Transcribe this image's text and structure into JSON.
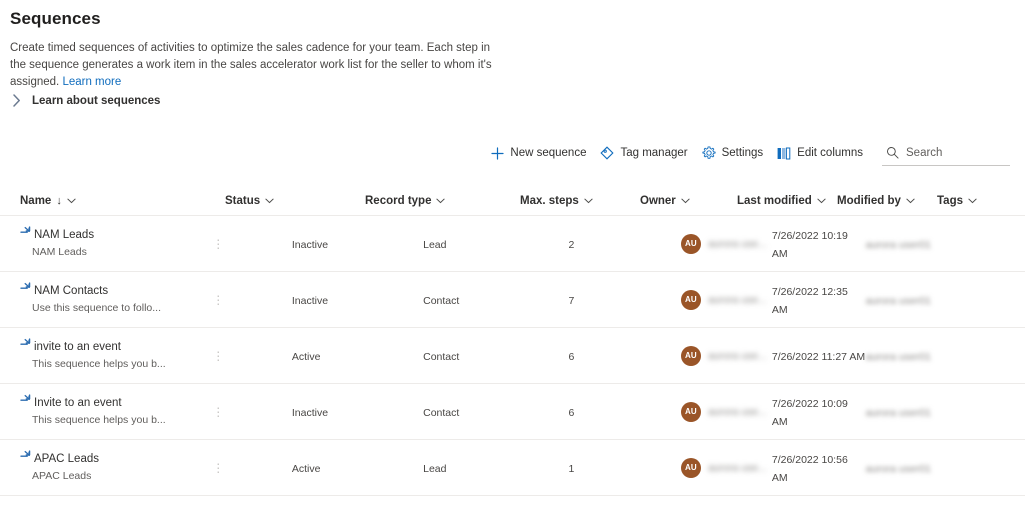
{
  "header": {
    "title": "Sequences",
    "description": "Create timed sequences of activities to optimize the sales cadence for your team. Each step in the sequence generates a work item in the sales accelerator work list for the seller to whom it's assigned.",
    "learn_more": "Learn more",
    "learn_about_label": "Learn about sequences",
    "chevron_icon": "chevron-right-icon"
  },
  "commandbar": {
    "new_sequence": "New sequence",
    "tag_manager": "Tag manager",
    "settings": "Settings",
    "edit_columns": "Edit columns",
    "icons": {
      "new": "plus-icon",
      "tag": "tag-icon",
      "settings": "gear-icon",
      "columns": "edit-columns-icon",
      "search": "search-icon"
    }
  },
  "search": {
    "placeholder": "Search",
    "value": ""
  },
  "table": {
    "columns": [
      {
        "label": "Name",
        "sort": "↓"
      },
      {
        "label": "Status"
      },
      {
        "label": "Record type"
      },
      {
        "label": "Max. steps"
      },
      {
        "label": "Owner"
      },
      {
        "label": "Last modified"
      },
      {
        "label": "Modified by"
      },
      {
        "label": "Tags"
      }
    ],
    "rows": [
      {
        "name": "NAM Leads",
        "subtitle": "NAM Leads",
        "status": "Inactive",
        "record_type": "Lead",
        "max_steps": "2",
        "owner_initials": "AU",
        "owner_name": "aurora use...",
        "last_modified": "7/26/2022 10:19 AM",
        "modified_by": "aurora user01",
        "tags": ""
      },
      {
        "name": "NAM Contacts",
        "subtitle": "Use this sequence to follo...",
        "status": "Inactive",
        "record_type": "Contact",
        "max_steps": "7",
        "owner_initials": "AU",
        "owner_name": "aurora use...",
        "last_modified": "7/26/2022 12:35 AM",
        "modified_by": "aurora user01",
        "tags": ""
      },
      {
        "name": "invite to an event",
        "subtitle": "This sequence helps you b...",
        "status": "Active",
        "record_type": "Contact",
        "max_steps": "6",
        "owner_initials": "AU",
        "owner_name": "aurora use...",
        "last_modified": "7/26/2022 11:27 AM",
        "modified_by": "aurora user01",
        "tags": ""
      },
      {
        "name": "Invite to an event",
        "subtitle": "This sequence helps you b...",
        "status": "Inactive",
        "record_type": "Contact",
        "max_steps": "6",
        "owner_initials": "AU",
        "owner_name": "aurora use...",
        "last_modified": "7/26/2022 10:09 AM",
        "modified_by": "aurora user01",
        "tags": ""
      },
      {
        "name": "APAC Leads",
        "subtitle": "APAC Leads",
        "status": "Active",
        "record_type": "Lead",
        "max_steps": "1",
        "owner_initials": "AU",
        "owner_name": "aurora use...",
        "last_modified": "7/26/2022 10:56 AM",
        "modified_by": "aurora user01",
        "tags": ""
      }
    ],
    "row_menu_icon": "more-vertical-icon",
    "row_item_icon": "sequence-icon"
  },
  "colors": {
    "link": "#0f6cbd",
    "accent": "#0f6cbd",
    "avatar": "#9a5528",
    "divider": "#edebe9"
  }
}
